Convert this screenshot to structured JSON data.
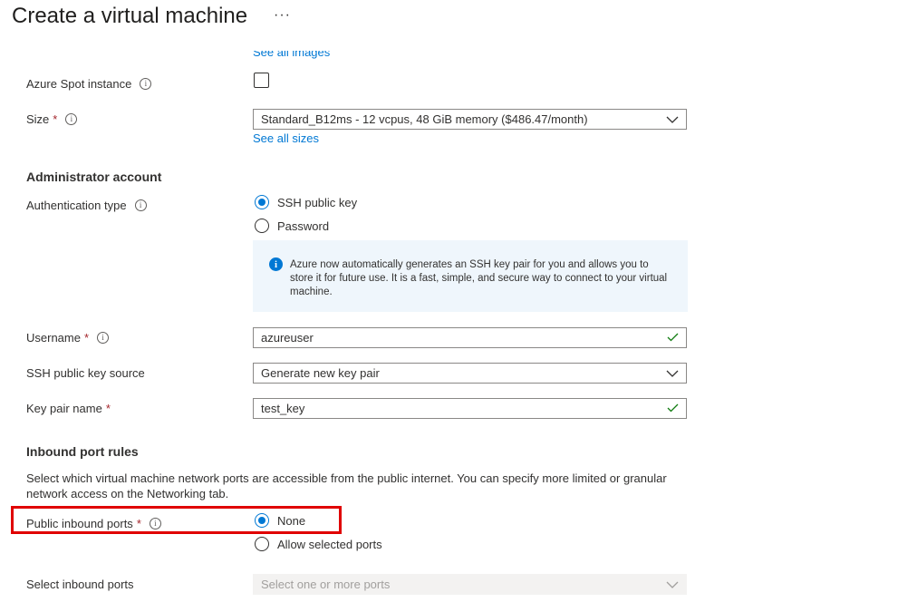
{
  "page": {
    "title": "Create a virtual machine",
    "more_label": "···"
  },
  "image": {
    "see_all_images": "See all images"
  },
  "spot": {
    "label": "Azure Spot instance",
    "checked": false
  },
  "size": {
    "label": "Size",
    "required": "*",
    "value": "Standard_B12ms - 12 vcpus, 48 GiB memory ($486.47/month)",
    "see_all_sizes": "See all sizes"
  },
  "admin": {
    "heading": "Administrator account",
    "auth_label": "Authentication type",
    "auth_options": [
      "SSH public key",
      "Password"
    ],
    "auth_selected": "SSH public key",
    "info_message": "Azure now automatically generates an SSH key pair for you and allows you to store it for future use. It is a fast, simple, and secure way to connect to your virtual machine.",
    "username_label": "Username",
    "username_value": "azureuser",
    "ssh_source_label": "SSH public key source",
    "ssh_source_value": "Generate new key pair",
    "key_pair_label": "Key pair name",
    "key_pair_value": "test_key",
    "required": "*"
  },
  "inbound": {
    "heading": "Inbound port rules",
    "description": "Select which virtual machine network ports are accessible from the public internet. You can specify more limited or granular network access on the Networking tab.",
    "public_ports_label": "Public inbound ports",
    "required": "*",
    "options": [
      "None",
      "Allow selected ports"
    ],
    "selected": "None",
    "select_ports_label": "Select inbound ports",
    "select_ports_placeholder": "Select one or more ports"
  },
  "colors": {
    "accent": "#0078d4",
    "required": "#a4262c",
    "valid": "#107c10",
    "highlight": "#e00000",
    "info_bg": "#eff6fc"
  },
  "icons": {
    "info": "info-icon",
    "chevron": "chevron-down-icon",
    "check": "checkmark-icon"
  }
}
